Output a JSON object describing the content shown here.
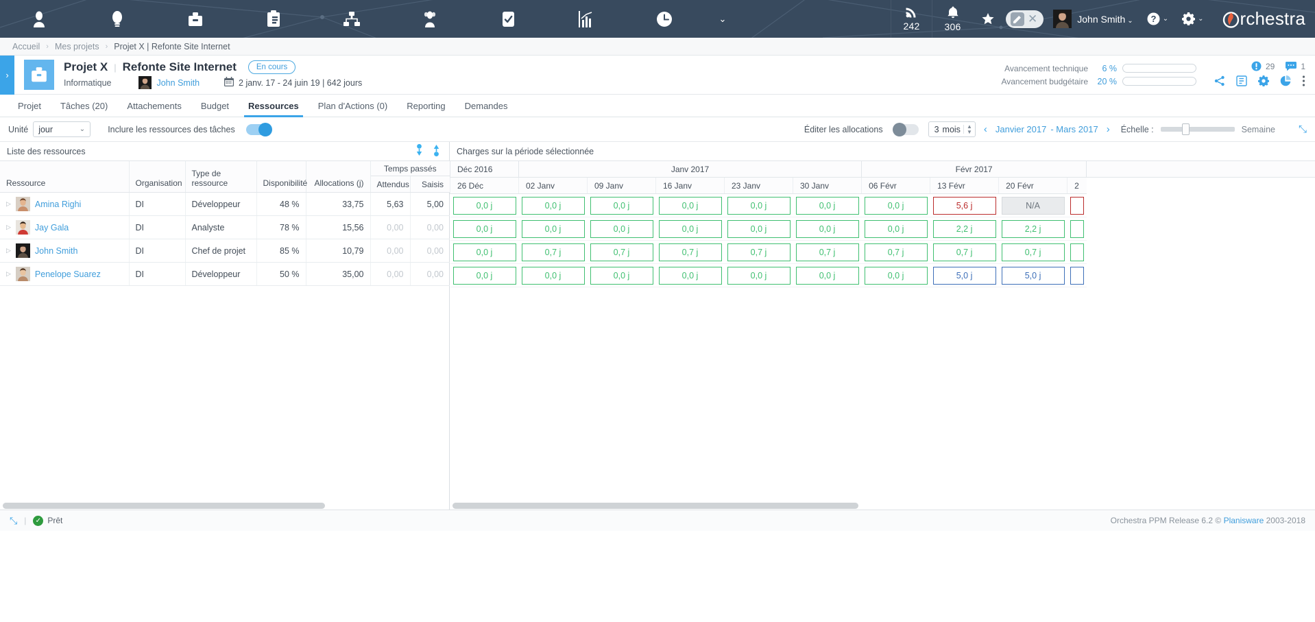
{
  "topnav": {
    "icons": [
      {
        "name": "user-icon",
        "glyph": "person"
      },
      {
        "name": "idea-bulb-icon",
        "glyph": "bulb"
      },
      {
        "name": "briefcase-icon",
        "glyph": "briefcase"
      },
      {
        "name": "clipboard-icon",
        "glyph": "clipboard"
      },
      {
        "name": "org-chart-icon",
        "glyph": "orgchart"
      },
      {
        "name": "people-icon",
        "glyph": "people"
      },
      {
        "name": "checkbox-task-icon",
        "glyph": "check"
      },
      {
        "name": "analytics-chart-icon",
        "glyph": "chart"
      },
      {
        "name": "clock-icon",
        "glyph": "clock"
      }
    ],
    "more_chevron": "⌄",
    "feed_count": "242",
    "bell_count": "306",
    "user_name": "John Smith",
    "user_caret": "⌄",
    "help_glyph": "?",
    "help_caret": "⌄",
    "gear_caret": "⌄",
    "brand": "rchestra",
    "brand_initial": "O"
  },
  "breadcrumb": {
    "items": [
      "Accueil",
      "Mes projets",
      "Projet X | Refonte Site Internet"
    ],
    "separator": "›"
  },
  "project_header": {
    "expand_chevron": "›",
    "name": "Projet X",
    "divider": "|",
    "subtitle": "Refonte Site Internet",
    "status_badge": "En cours",
    "organisation": "Informatique",
    "owner": "John Smith",
    "dates": "2 janv. 17 - 24 juin 19 | 642 jours",
    "progress": [
      {
        "label": "Avancement technique",
        "value": "6 %",
        "percent": 6
      },
      {
        "label": "Avancement budgétaire",
        "value": "20 %",
        "percent": 20
      }
    ],
    "alerts_count": "29",
    "comments_count": "1",
    "actions": [
      "share-icon",
      "report-icon",
      "settings-icon",
      "pie-chart-icon",
      "more-vertical-icon"
    ]
  },
  "tabs": [
    {
      "label": "Projet",
      "active": false
    },
    {
      "label": "Tâches (20)",
      "active": false
    },
    {
      "label": "Attachements",
      "active": false
    },
    {
      "label": "Budget",
      "active": false
    },
    {
      "label": "Ressources",
      "active": true
    },
    {
      "label": "Plan d'Actions (0)",
      "active": false
    },
    {
      "label": "Reporting",
      "active": false
    },
    {
      "label": "Demandes",
      "active": false
    }
  ],
  "toolbar": {
    "unit_label": "Unité",
    "unit_value": "jour",
    "unit_caret": "⌄",
    "include_tasks_label": "Inclure les ressources des tâches",
    "include_tasks_on": true,
    "edit_allocations_label": "Éditer les allocations",
    "edit_allocations_on": false,
    "months_value": "3",
    "months_unit": "mois",
    "prev_arrow": "‹",
    "next_arrow": "›",
    "period_start": "Janvier 2017",
    "period_end": "- Mars 2017",
    "scale_label": "Échelle :",
    "scale_value": "Semaine",
    "expand_icon": "⤡"
  },
  "left_panel": {
    "title": "Liste des ressources",
    "group_header": "Temps passés",
    "columns": [
      "Ressource",
      "Organisation",
      "Type de ressource",
      "Disponibilité",
      "Allocations (j)",
      "Attendus",
      "Saisis"
    ],
    "rows": [
      {
        "resource": "Amina Righi",
        "org": "DI",
        "type": "Développeur",
        "availability": "48 %",
        "allocations": "33,75",
        "attendus": "5,63",
        "saisis": "5,00",
        "muted": false
      },
      {
        "resource": "Jay Gala",
        "org": "DI",
        "type": "Analyste",
        "availability": "78 %",
        "allocations": "15,56",
        "attendus": "0,00",
        "saisis": "0,00",
        "muted": true
      },
      {
        "resource": "John Smith",
        "org": "DI",
        "type": "Chef de projet",
        "availability": "85 %",
        "allocations": "10,79",
        "attendus": "0,00",
        "saisis": "0,00",
        "muted": true
      },
      {
        "resource": "Penelope Suarez",
        "org": "DI",
        "type": "Développeur",
        "availability": "50 %",
        "allocations": "35,00",
        "attendus": "0,00",
        "saisis": "0,00",
        "muted": true
      }
    ]
  },
  "right_panel": {
    "title": "Charges sur la période sélectionnée",
    "months": [
      {
        "label": "Déc 2016",
        "span": 1
      },
      {
        "label": "Janv 2017",
        "span": 5
      },
      {
        "label": "Févr 2017",
        "span": 4
      }
    ],
    "weeks": [
      "26 Déc",
      "02 Janv",
      "09 Janv",
      "16 Janv",
      "23 Janv",
      "30 Janv",
      "06 Févr",
      "13 Févr",
      "20 Févr",
      "2"
    ],
    "rows": [
      {
        "resource": "Amina Righi",
        "cells": [
          {
            "v": "0,0 j",
            "s": "green"
          },
          {
            "v": "0,0 j",
            "s": "green"
          },
          {
            "v": "0,0 j",
            "s": "green"
          },
          {
            "v": "0,0 j",
            "s": "green"
          },
          {
            "v": "0,0 j",
            "s": "green"
          },
          {
            "v": "0,0 j",
            "s": "green"
          },
          {
            "v": "0,0 j",
            "s": "green"
          },
          {
            "v": "5,6 j",
            "s": "red"
          },
          {
            "v": "N/A",
            "s": "na"
          },
          {
            "v": "",
            "s": "red"
          }
        ]
      },
      {
        "resource": "Jay Gala",
        "cells": [
          {
            "v": "0,0 j",
            "s": "green"
          },
          {
            "v": "0,0 j",
            "s": "green"
          },
          {
            "v": "0,0 j",
            "s": "green"
          },
          {
            "v": "0,0 j",
            "s": "green"
          },
          {
            "v": "0,0 j",
            "s": "green"
          },
          {
            "v": "0,0 j",
            "s": "green"
          },
          {
            "v": "0,0 j",
            "s": "green"
          },
          {
            "v": "2,2 j",
            "s": "green"
          },
          {
            "v": "2,2 j",
            "s": "green"
          },
          {
            "v": "",
            "s": "green"
          }
        ]
      },
      {
        "resource": "John Smith",
        "cells": [
          {
            "v": "0,0 j",
            "s": "green"
          },
          {
            "v": "0,7 j",
            "s": "green"
          },
          {
            "v": "0,7 j",
            "s": "green"
          },
          {
            "v": "0,7 j",
            "s": "green"
          },
          {
            "v": "0,7 j",
            "s": "green"
          },
          {
            "v": "0,7 j",
            "s": "green"
          },
          {
            "v": "0,7 j",
            "s": "green"
          },
          {
            "v": "0,7 j",
            "s": "green"
          },
          {
            "v": "0,7 j",
            "s": "green"
          },
          {
            "v": "",
            "s": "green"
          }
        ]
      },
      {
        "resource": "Penelope Suarez",
        "cells": [
          {
            "v": "0,0 j",
            "s": "green"
          },
          {
            "v": "0,0 j",
            "s": "green"
          },
          {
            "v": "0,0 j",
            "s": "green"
          },
          {
            "v": "0,0 j",
            "s": "green"
          },
          {
            "v": "0,0 j",
            "s": "green"
          },
          {
            "v": "0,0 j",
            "s": "green"
          },
          {
            "v": "0,0 j",
            "s": "green"
          },
          {
            "v": "5,0 j",
            "s": "blue"
          },
          {
            "v": "5,0 j",
            "s": "blue"
          },
          {
            "v": "",
            "s": "blue"
          }
        ]
      }
    ]
  },
  "statusbar": {
    "expand_icon": "⤡",
    "separator": "|",
    "ready_label": "Prêt",
    "ready_glyph": "✓",
    "copyright_pre": "Orchestra PPM Release 6.2 © ",
    "copyright_link": "Planisware",
    "copyright_post": " 2003-2018"
  },
  "colors": {
    "nav_bg": "#384a5e",
    "accent": "#3ba4e8",
    "green": "#3fbf70",
    "red": "#ba2b2b",
    "blue": "#3d6fb8"
  }
}
